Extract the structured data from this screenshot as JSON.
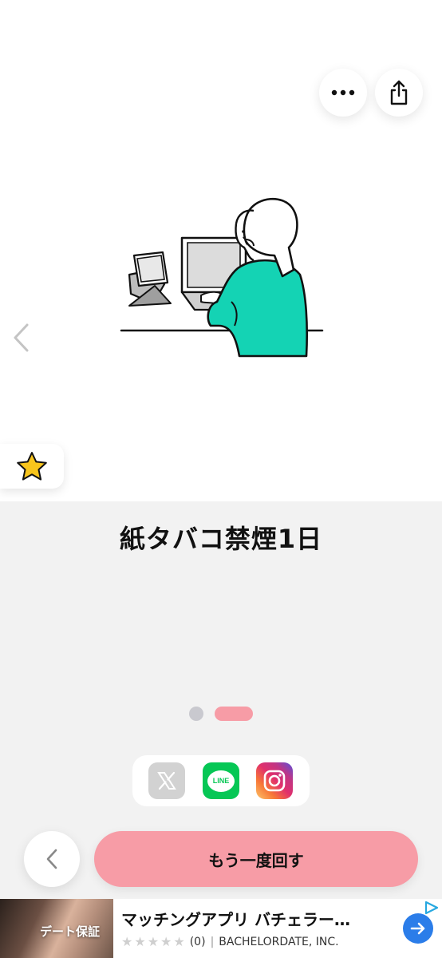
{
  "header": {
    "more_icon": "ellipsis-icon",
    "share_icon": "share-icon"
  },
  "card": {
    "illustration": "woman-at-laptop-illustration",
    "title": "紙タバコ禁煙1日",
    "favorite_icon": "star-icon",
    "prev_icon": "chevron-left-icon"
  },
  "pager": {
    "total": 2,
    "active_index": 1
  },
  "share": {
    "items": [
      {
        "name": "x",
        "icon": "x-logo-icon",
        "state": "disabled"
      },
      {
        "name": "line",
        "label": "LINE",
        "icon": "line-logo-icon"
      },
      {
        "name": "instagram",
        "icon": "instagram-logo-icon"
      }
    ]
  },
  "actions": {
    "back_icon": "chevron-left-icon",
    "spin_again_label": "もう一度回す"
  },
  "ad": {
    "image_text": "デート保証",
    "title": "マッチングアプリ バチェラー…",
    "rating_count": "(0)",
    "separator": "|",
    "publisher": "BACHELORDATE, INC."
  },
  "colors": {
    "accent_pink": "#f79ca6",
    "teal": "#14d3b4",
    "line_green": "#06c755",
    "ad_blue": "#2b7de9",
    "background": "#f2f2f2"
  }
}
